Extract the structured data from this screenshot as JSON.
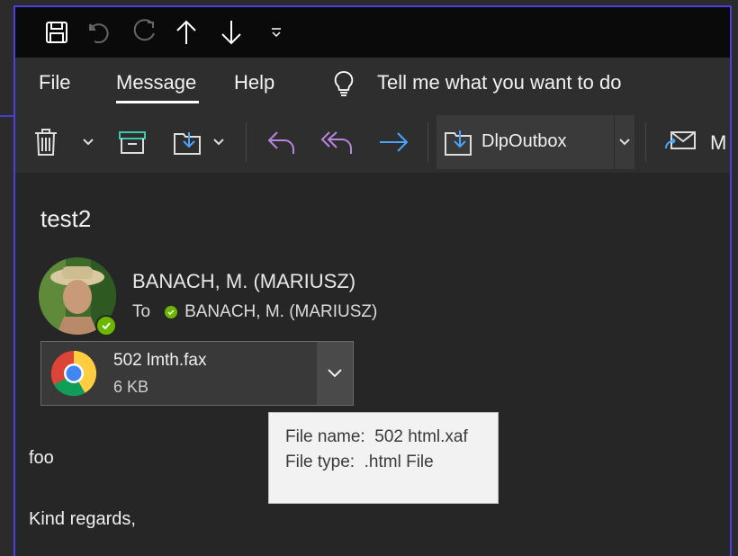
{
  "titlebar": {
    "icons": [
      "save-icon",
      "undo-icon",
      "redo-icon",
      "up-arrow-icon",
      "down-arrow-icon",
      "customize-toolbar-icon"
    ]
  },
  "menu": {
    "file": "File",
    "message": "Message",
    "help": "Help",
    "tell_me": "Tell me what you want to do",
    "active": "Message"
  },
  "ribbon": {
    "move_folder": "DlpOutbox",
    "next_button_partial": "M"
  },
  "message": {
    "subject": "test2",
    "sender": "BANACH, M. (MARIUSZ)",
    "to_label": "To",
    "recipient": "BANACH, M. (MARIUSZ)",
    "attachment": {
      "name": "502 lmth.fax",
      "size": "6 KB",
      "icon": "chrome-icon"
    },
    "tooltip": {
      "file_name_label": "File name:",
      "file_name": "502 html.xaf",
      "file_type_label": "File type:",
      "file_type": ".html File"
    },
    "body": [
      "foo",
      "Kind regards,"
    ]
  },
  "colors": {
    "accent_border": "#4b3fe0",
    "reply_purple": "#b784e0",
    "forward_blue": "#4aa3ff",
    "presence_green": "#6bb700"
  }
}
